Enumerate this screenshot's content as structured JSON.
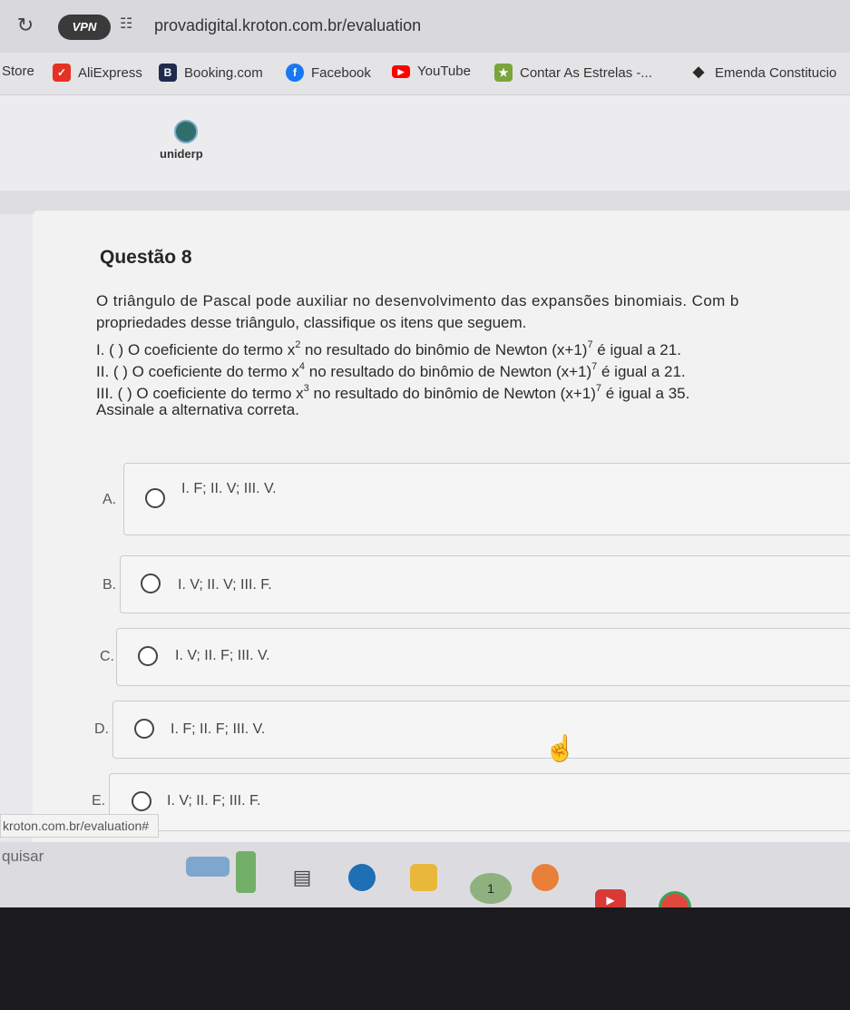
{
  "browser": {
    "extension_badge": "VPN",
    "url": "provadigital.kroton.com.br/evaluation",
    "bookmarks": [
      {
        "label": "Store",
        "icon": "store-icon",
        "color": "#e4e3e6"
      },
      {
        "label": "AliExpress",
        "icon": "aliexpress-icon",
        "color": "#e43225"
      },
      {
        "label": "Booking.com",
        "icon": "booking-icon",
        "color": "#1f2b4d"
      },
      {
        "label": "Facebook",
        "icon": "facebook-icon",
        "color": "#1877f2"
      },
      {
        "label": "YouTube",
        "icon": "youtube-icon",
        "color": "#ff0000"
      },
      {
        "label": "Contar As Estrelas -...",
        "icon": "star-icon",
        "color": "#7aa53a"
      },
      {
        "label": "Emenda Constitucio",
        "icon": "diamond-icon",
        "color": "#2a2a2a"
      }
    ]
  },
  "site": {
    "logo_text": "uniderp"
  },
  "question": {
    "title": "Questão 8",
    "intro_line1": "O triângulo de Pascal pode auxiliar no desenvolvimento das expansões binomiais. Com b",
    "intro_line2": "propriedades desse triângulo, classifique os itens que seguem.",
    "items": [
      {
        "prefix": "I. ( ) O coeficiente do termo x",
        "exp": "2",
        "mid": " no resultado do binômio de Newton (x+1)",
        "exp2": "7",
        "suffix": " é igual a 21."
      },
      {
        "prefix": "II. ( ) O coeficiente do termo x",
        "exp": "4",
        "mid": " no resultado do binômio de Newton (x+1)",
        "exp2": "7",
        "suffix": " é igual a 21."
      },
      {
        "prefix": "III. ( ) O coeficiente do termo x",
        "exp": "3",
        "mid": " no resultado do binômio de Newton (x+1)",
        "exp2": "7",
        "suffix": " é igual a 35."
      }
    ],
    "instruction": "Assinale a alternativa correta.",
    "options": [
      {
        "letter": "A.",
        "text": "I. F; II. V; III. V."
      },
      {
        "letter": "B.",
        "text": "I. V; II. V; III. F."
      },
      {
        "letter": "C.",
        "text": "I. V; II. F; III. V."
      },
      {
        "letter": "D.",
        "text": "I. F; II. F; III. V."
      },
      {
        "letter": "E.",
        "text": "I. V; II. F; III. F."
      }
    ]
  },
  "status_bar": "kroton.com.br/evaluation#",
  "taskbar": {
    "search_label": "quisar",
    "notification_count": "1"
  }
}
